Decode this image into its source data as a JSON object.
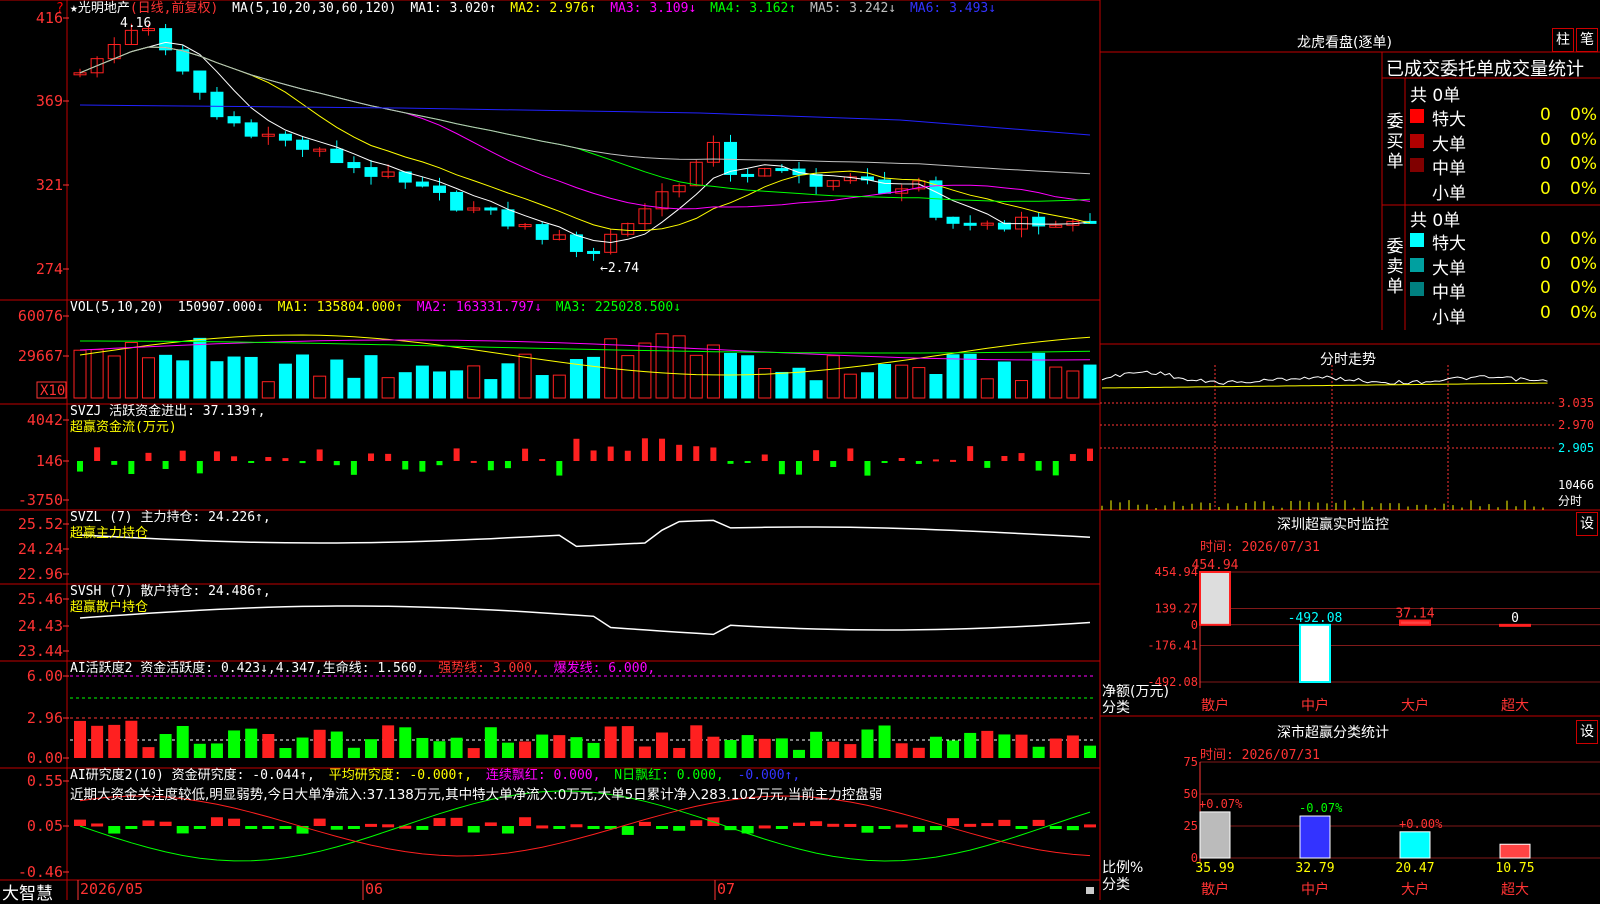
{
  "stock": {
    "name": "★光明地产",
    "period": "(日线,前复权)",
    "ma_label": "MA(5,10,20,30,60,120)",
    "ma_values": [
      {
        "text": "MA1: 3.020↑",
        "color": "#ffffff"
      },
      {
        "text": "MA2: 2.976↑",
        "color": "#ffff00"
      },
      {
        "text": "MA3: 3.109↓",
        "color": "#ff00ff"
      },
      {
        "text": "MA4: 3.162↑",
        "color": "#00ff00"
      },
      {
        "text": "MA5: 3.242↓",
        "color": "#c0c0c0"
      },
      {
        "text": "MA6: 3.493↓",
        "color": "#2222ff"
      }
    ],
    "high_mark": "4.16",
    "low_mark": "←2.74",
    "y_ticks": [
      "416",
      "369",
      "321",
      "274"
    ],
    "corner": "?"
  },
  "volume": {
    "label": "VOL(5,10,20)",
    "value": "150907.000↓",
    "ma": [
      {
        "text": "MA1: 135804.000↑",
        "color": "#ffff00"
      },
      {
        "text": "MA2: 163331.797↓",
        "color": "#ff00ff"
      },
      {
        "text": "MA3: 225028.500↓",
        "color": "#00ff00"
      }
    ],
    "y_ticks": [
      "60076",
      "29667"
    ],
    "unit": "X10"
  },
  "svzj": {
    "label": "SVZJ  活跃资金进出: 37.139↑,",
    "sub": "超赢资金流(万元)",
    "y_ticks": [
      "4042",
      "146",
      "-3750"
    ]
  },
  "svzl": {
    "label": "SVZL (7) 主力持仓: 24.226↑,",
    "sub": "超赢主力持仓",
    "y_ticks": [
      "25.52",
      "24.24",
      "22.96"
    ]
  },
  "svsh": {
    "label": "SVSH (7) 散户持仓: 24.486↑,",
    "sub": "超赢散户持仓",
    "y_ticks": [
      "25.46",
      "24.43",
      "23.44"
    ]
  },
  "ai_active": {
    "label": "AI活跃度2 资金活跃度: 0.423↓,4.347,生命线: 1.560,",
    "strong": "强势线: 3.000,",
    "burst": "爆发线: 6.000,",
    "y_ticks": [
      "6.00",
      "2.96",
      "0.00"
    ]
  },
  "ai_research": {
    "label": "AI研究度2(10) 资金研究度: -0.044↑,",
    "avg": "平均研究度: -0.000↑,",
    "cont": "连续飘红: 0.000,",
    "nday": "N日飘红: 0.000,",
    "last": "-0.000↑,",
    "note": "近期大资金关注度较低,明显弱势,今日大单净流入:37.138万元,其中特大单净流入:0万元,大单5日累计净入283.102万元,当前主力控盘弱",
    "y_ticks": [
      "0.55",
      "0.05",
      "-0.46"
    ]
  },
  "footer": {
    "brand": "大智慧",
    "dates": [
      "2026/05",
      "06",
      "07"
    ]
  },
  "right": {
    "dragon_title": "龙虎看盘(逐单)",
    "btn_zhu": "柱",
    "btn_bi": "笔",
    "tabs_title": "已成交委托单成交量统计",
    "buy_total": "共 0单",
    "buy_label": "委买单",
    "sell_total": "共 0单",
    "sell_label": "委卖单",
    "buy_rows": [
      {
        "name": "特大",
        "count": "0",
        "pct": "0%",
        "color": "#ff0000"
      },
      {
        "name": "大单",
        "count": "0",
        "pct": "0%",
        "color": "#b00000"
      },
      {
        "name": "中单",
        "count": "0",
        "pct": "0%",
        "color": "#800000"
      },
      {
        "name": "小单",
        "count": "0",
        "pct": "0%",
        "color": "#000000"
      }
    ],
    "sell_rows": [
      {
        "name": "特大",
        "count": "0",
        "pct": "0%",
        "color": "#00ffff"
      },
      {
        "name": "大单",
        "count": "0",
        "pct": "0%",
        "color": "#00a0a0"
      },
      {
        "name": "中单",
        "count": "0",
        "pct": "0%",
        "color": "#008080"
      },
      {
        "name": "小单",
        "count": "0",
        "pct": "0%",
        "color": "#000000"
      }
    ],
    "intraday_title": "分时走势",
    "intraday_ticks": [
      "3.035",
      "2.970",
      "2.905"
    ],
    "intraday_vol": "10466",
    "intraday_unit": "分时",
    "monitor_title": "深圳超赢实时监控",
    "monitor_btn": "设",
    "monitor_time": "时间: 2026/07/31",
    "monitor_ticks": [
      "454.94",
      "139.27",
      "0",
      "-176.41",
      "-492.08"
    ],
    "monitor_ylabel": "净额(万元)",
    "monitor_xlabel": "分类",
    "classify_title": "深市超赢分类统计",
    "classify_btn": "设",
    "classify_time": "时间: 2026/07/31",
    "classify_ticks": [
      "75",
      "50",
      "25",
      "0"
    ],
    "classify_ylabel": "比例%",
    "classify_xlabel": "分类"
  },
  "chart_data": [
    {
      "type": "bar",
      "title": "深圳超赢实时监控",
      "ylabel": "净额(万元)",
      "xlabel": "分类",
      "categories": [
        "散户",
        "中户",
        "大户",
        "超大"
      ],
      "values": [
        454.94,
        -492.08,
        37.14,
        0
      ],
      "value_labels": [
        "454.94",
        "-492.08",
        "37.14",
        "0"
      ],
      "ylim": [
        -492.08,
        454.94
      ]
    },
    {
      "type": "bar",
      "title": "深市超赢分类统计",
      "ylabel": "比例%",
      "xlabel": "分类",
      "categories": [
        "散户",
        "中户",
        "大户",
        "超大"
      ],
      "values": [
        35.99,
        32.79,
        20.47,
        10.75
      ],
      "change_labels": [
        "+0.07%",
        "-0.07%",
        "+0.00%",
        ""
      ],
      "ylim": [
        0,
        75
      ]
    }
  ]
}
